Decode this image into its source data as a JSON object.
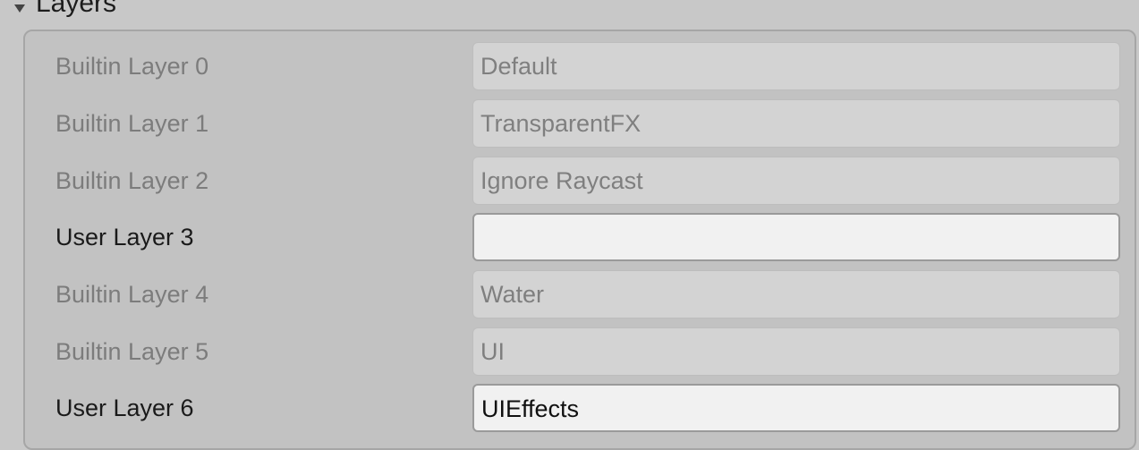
{
  "section": {
    "title": "Layers"
  },
  "layers": [
    {
      "label": "Builtin Layer 0",
      "value": "Default"
    },
    {
      "label": "Builtin Layer 1",
      "value": "TransparentFX"
    },
    {
      "label": "Builtin Layer 2",
      "value": "Ignore Raycast"
    },
    {
      "label": "User Layer 3",
      "value": ""
    },
    {
      "label": "Builtin Layer 4",
      "value": "Water"
    },
    {
      "label": "Builtin Layer 5",
      "value": "UI"
    },
    {
      "label": "User Layer 6",
      "value": "UIEffects"
    }
  ],
  "colors": {
    "background": "#c8c8c8",
    "builtin_text": "#7c7c7c",
    "user_text": "#1a1a1a",
    "user_field_background": "#f1f1f1",
    "builtin_field_background": "#d3d3d3"
  }
}
